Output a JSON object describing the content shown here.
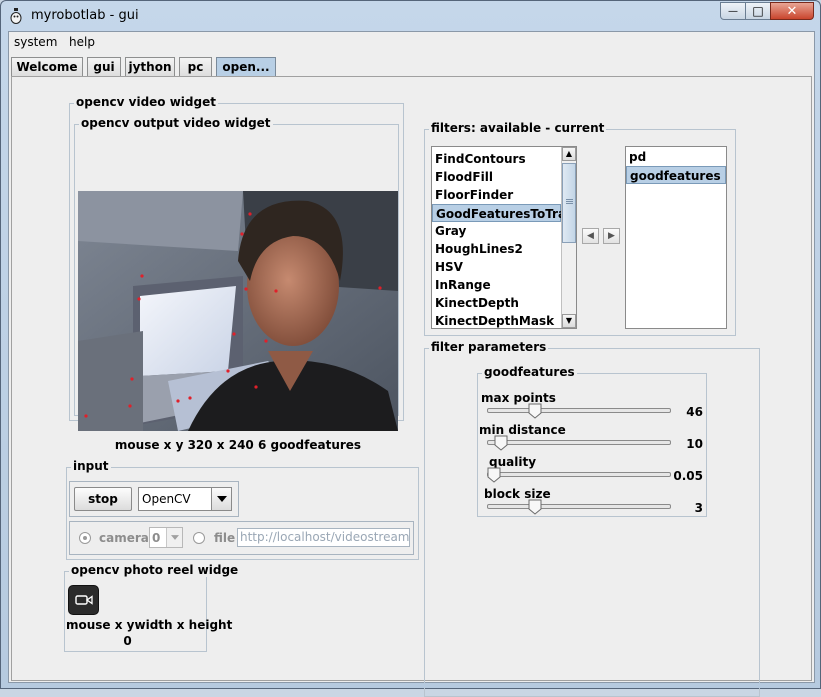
{
  "window": {
    "title": "myrobotlab - gui",
    "min_glyph": "—",
    "max_glyph": "□",
    "close_glyph": "✕"
  },
  "menu": [
    "system",
    "help"
  ],
  "tabs": [
    "Welcome",
    "gui",
    "jython",
    "pc",
    "open..."
  ],
  "active_tab": "open...",
  "video_widget": {
    "title": "opencv  video widget",
    "output_title": "opencv output video widget",
    "status": "mouse x y  320 x 240  6  goodfeatures"
  },
  "filters": {
    "title": "filters: available - current",
    "available": [
      "FindContours",
      "FloodFill",
      "FloorFinder",
      "GoodFeaturesToTrack",
      "Gray",
      "HoughLines2",
      "HSV",
      "InRange",
      "KinectDepth",
      "KinectDepthMask"
    ],
    "available_selected": "GoodFeaturesToTrack",
    "current": [
      "pd",
      "goodfeatures"
    ],
    "current_selected": "goodfeatures"
  },
  "filter_parameters": {
    "title": "filter parameters",
    "filter_name": "goodfeatures",
    "sliders": [
      {
        "label": "max points",
        "value": "46",
        "position": 0.24
      },
      {
        "label": "min distance",
        "value": "10",
        "position": 0.04
      },
      {
        "label": "quality",
        "value": "0.05",
        "position": 0.0
      },
      {
        "label": "block size",
        "value": "3",
        "position": 0.24
      }
    ]
  },
  "input": {
    "title": "input",
    "stop_label": "stop",
    "source_value": "OpenCV",
    "camera_label": "camera",
    "camera_index": "0",
    "file_label": "file",
    "file_value": "http://localhost/videostream.cgi"
  },
  "photo_reel": {
    "title": "opencv  photo reel widge",
    "line1": "mouse x ywidth x height",
    "line2": "0"
  },
  "colors": {
    "selection": "#b8cfe5",
    "feature_point": "#e0202a",
    "title_bar": "#c5d7ea"
  }
}
